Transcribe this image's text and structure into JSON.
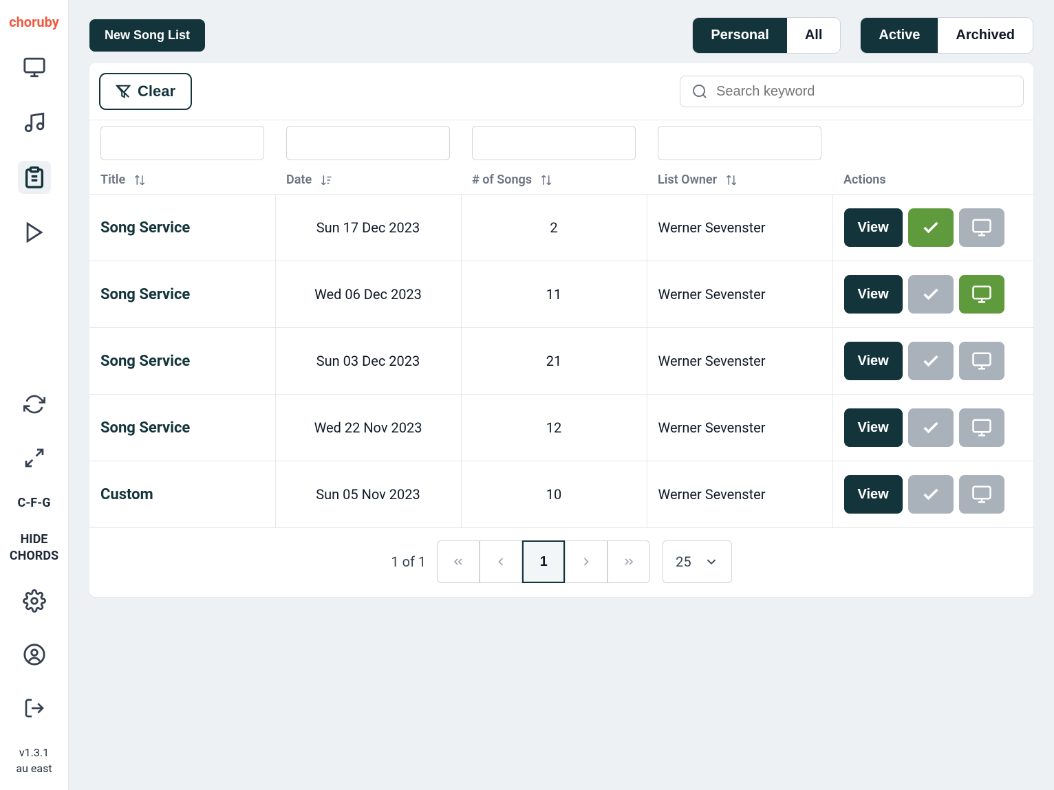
{
  "brand": "choruby",
  "sidebar": {
    "cfg_label": "C-F-G",
    "hide_chords_label": "HIDE CHORDS",
    "version_line1": "v1.3.1",
    "version_line2": "au east"
  },
  "header": {
    "new_button": "New Song List",
    "scope_toggle": {
      "personal": "Personal",
      "all": "All"
    },
    "status_toggle": {
      "active": "Active",
      "archived": "Archived"
    }
  },
  "filters": {
    "clear_label": "Clear",
    "search_placeholder": "Search keyword"
  },
  "columns": {
    "title": "Title",
    "date": "Date",
    "songs": "# of Songs",
    "owner": "List Owner",
    "actions": "Actions"
  },
  "rows": [
    {
      "title": "Song Service",
      "date": "Sun 17 Dec 2023",
      "songs": "2",
      "owner": "Werner Sevenster",
      "check_active": true,
      "display_active": false
    },
    {
      "title": "Song Service",
      "date": "Wed 06 Dec 2023",
      "songs": "11",
      "owner": "Werner Sevenster",
      "check_active": false,
      "display_active": true
    },
    {
      "title": "Song Service",
      "date": "Sun 03 Dec 2023",
      "songs": "21",
      "owner": "Werner Sevenster",
      "check_active": false,
      "display_active": false
    },
    {
      "title": "Song Service",
      "date": "Wed 22 Nov 2023",
      "songs": "12",
      "owner": "Werner Sevenster",
      "check_active": false,
      "display_active": false
    },
    {
      "title": "Custom",
      "date": "Sun 05 Nov 2023",
      "songs": "10",
      "owner": "Werner Sevenster",
      "check_active": false,
      "display_active": false
    }
  ],
  "actions": {
    "view": "View"
  },
  "pagination": {
    "info": "1 of 1",
    "current": "1",
    "page_size": "25"
  }
}
